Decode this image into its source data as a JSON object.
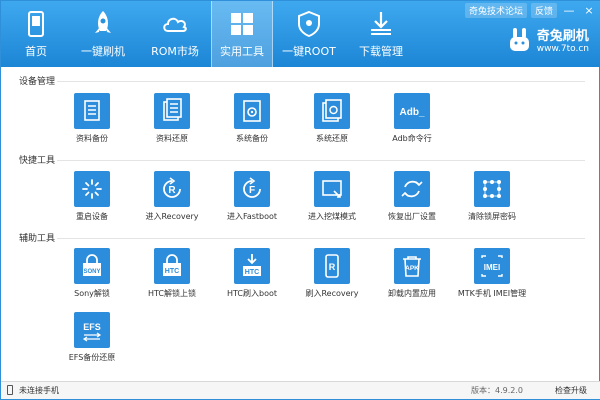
{
  "header": {
    "nav": [
      {
        "label": "首页",
        "icon": "phone-home-icon"
      },
      {
        "label": "一键刷机",
        "icon": "rocket-icon"
      },
      {
        "label": "ROM市场",
        "icon": "cloud-icon"
      },
      {
        "label": "实用工具",
        "icon": "grid-icon",
        "active": true
      },
      {
        "label": "一键ROOT",
        "icon": "shield-icon"
      },
      {
        "label": "下载管理",
        "icon": "download-icon"
      }
    ],
    "forum_label": "奇兔技术论坛",
    "feedback_label": "反馈",
    "minimize_glyph": "—",
    "close_glyph": "×",
    "brand_name": "奇兔刷机",
    "brand_url": "www.7to.cn"
  },
  "sections": [
    {
      "title": "设备管理"
    },
    {
      "title": "快捷工具"
    },
    {
      "title": "辅助工具"
    }
  ],
  "tools": {
    "device": [
      {
        "label": "资料备份",
        "icon": "document-icon"
      },
      {
        "label": "资料还原",
        "icon": "document-restore-icon"
      },
      {
        "label": "系统备份",
        "icon": "system-backup-icon"
      },
      {
        "label": "系统还原",
        "icon": "system-restore-icon"
      },
      {
        "label": "Adb命令行",
        "icon": "adb-icon",
        "icon_text": "Adb_"
      }
    ],
    "quick": [
      {
        "label": "重启设备",
        "icon": "reboot-icon"
      },
      {
        "label": "进入Recovery",
        "icon": "recovery-icon",
        "icon_text": "R"
      },
      {
        "label": "进入Fastboot",
        "icon": "fastboot-icon",
        "icon_text": "F"
      },
      {
        "label": "进入挖煤模式",
        "icon": "mining-mode-icon"
      },
      {
        "label": "恢复出厂设置",
        "icon": "factory-reset-icon"
      },
      {
        "label": "清除锁屏密码",
        "icon": "pattern-lock-icon"
      }
    ],
    "aux": [
      {
        "label": "Sony解锁",
        "icon": "sony-unlock-icon",
        "icon_text": "SONY"
      },
      {
        "label": "HTC解锁上锁",
        "icon": "htc-lock-icon",
        "icon_text": "HTC"
      },
      {
        "label": "HTC刷入boot",
        "icon": "htc-boot-icon",
        "icon_text": "HTC"
      },
      {
        "label": "刷入Recovery",
        "icon": "flash-recovery-icon",
        "icon_text": "R"
      },
      {
        "label": "卸载内置应用",
        "icon": "apk-uninstall-icon",
        "icon_text": "APK"
      },
      {
        "label": "MTK手机 IMEI管理",
        "icon": "imei-icon",
        "icon_text": "IMEI"
      },
      {
        "label": "EFS备份还原",
        "icon": "efs-icon",
        "icon_text": "EFS"
      }
    ]
  },
  "status": {
    "connection": "未连接手机",
    "version": "版本：4.9.2.0",
    "update": "检查升级"
  },
  "colors": {
    "header": "#1c86d6",
    "tile": "#2b8ddb"
  }
}
